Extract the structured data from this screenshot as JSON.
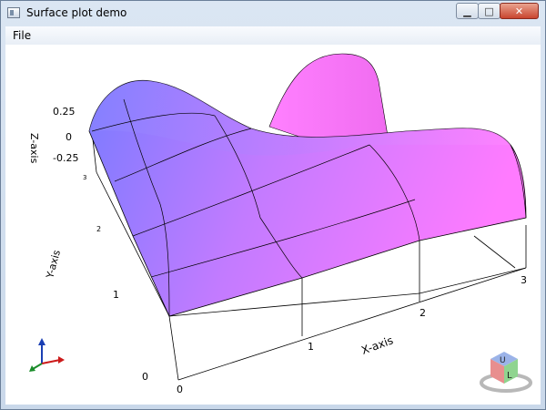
{
  "window": {
    "title": "Surface plot demo"
  },
  "menu": {
    "items": [
      "File"
    ]
  },
  "plot": {
    "axes": {
      "x_label": "X-axis",
      "y_label": "Y-axis",
      "z_label": "Z-axis"
    },
    "x_ticks": [
      "0",
      "1",
      "2",
      "3"
    ],
    "y_ticks": [
      "0",
      "1",
      "2",
      "3"
    ],
    "z_ticks": [
      "0.25",
      "0",
      "-0.25"
    ],
    "colors": {
      "surface_low": "#7b7bff",
      "surface_high": "#ff7bff",
      "mesh": "#000000"
    },
    "nav_cube": {
      "face_up": "U",
      "face_left": "L"
    }
  }
}
